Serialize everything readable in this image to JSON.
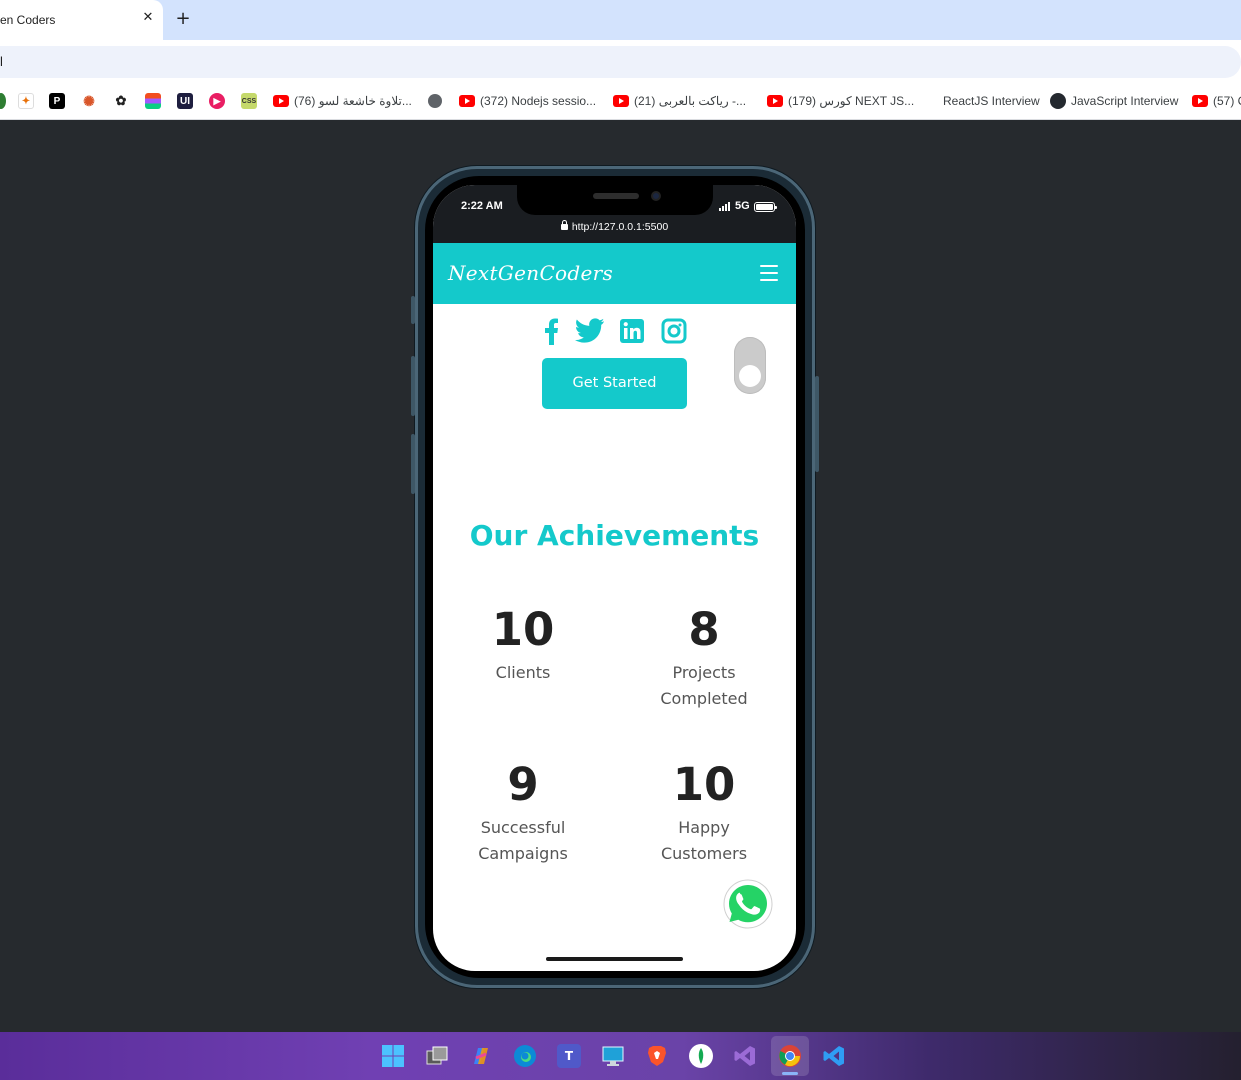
{
  "browser": {
    "tab_title": "en Coders",
    "tab_close": "✕",
    "new_tab": "+",
    "omnibox_text": "l",
    "bookmarks": [
      {
        "label": "(76) تلاوة خاشعة لسو...",
        "icon": "youtube-icon"
      },
      {
        "label": "",
        "icon": "globe-icon"
      },
      {
        "label": "(372) Nodejs sessio...",
        "icon": "youtube-icon"
      },
      {
        "label": "(21) رياكت بالعربى -...",
        "icon": "youtube-icon"
      },
      {
        "label": "(179) كورس NEXT JS...",
        "icon": "youtube-icon"
      },
      {
        "label": "ReactJS Interview",
        "icon": "none"
      },
      {
        "label": "JavaScript Interview",
        "icon": "github-icon"
      },
      {
        "label": "(57) C",
        "icon": "youtube-icon"
      }
    ]
  },
  "phone": {
    "status": {
      "time": "2:22 AM",
      "network": "5G",
      "url": "http://127.0.0.1:5500"
    },
    "navbar": {
      "brand": "NextGenCoders"
    },
    "cta_label": "Get Started",
    "section_title": "Our Achievements",
    "stats": [
      {
        "number": "10",
        "label": "Clients"
      },
      {
        "number": "8",
        "label": "Projects Completed"
      },
      {
        "number": "9",
        "label": "Successful Campaigns"
      },
      {
        "number": "10",
        "label": "Happy Customers"
      }
    ]
  },
  "colors": {
    "accent": "#14c9cb",
    "page_bg": "#262a2e",
    "text_dark": "#222222"
  },
  "taskbar": {
    "icons": [
      "windows-start-icon",
      "task-view-icon",
      "copilot-icon",
      "edge-icon",
      "teams-icon",
      "remote-desktop-icon",
      "brave-icon",
      "mongodb-compass-icon",
      "visual-studio-icon",
      "chrome-icon",
      "vscode-icon"
    ]
  }
}
